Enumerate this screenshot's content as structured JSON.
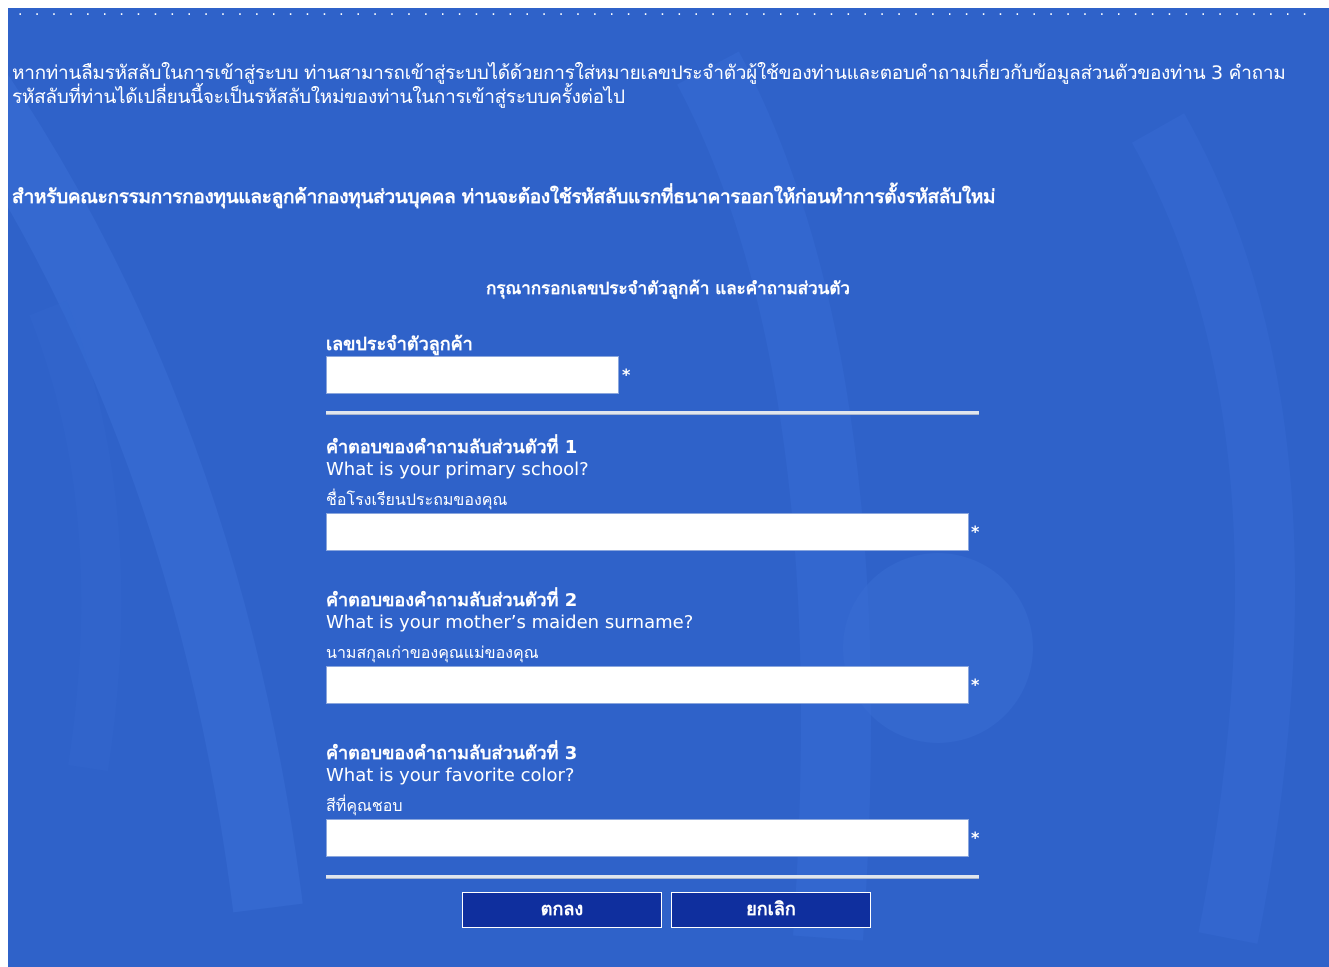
{
  "dots": "· · · · · · · · · · · · · · · · · · · · · · · · · · · · · · · · · · · · · · · · · · · · · · · · · · · · · · · · · · · · · · · · · · · · · · · · · · · · · · · · · · · · · · · · · · · · · · · · ·",
  "intro": {
    "paragraph1": "หากท่านลืมรหัสลับในการเข้าสู่ระบบ ท่านสามารถเข้าสู่ระบบได้ด้วยการใส่หมายเลขประจำตัวผู้ใช้ของท่านและตอบคำถามเกี่ยวกับข้อมูลส่วนตัวของท่าน 3 คำถาม รหัสลับที่ท่านได้เปลี่ยนนี้จะเป็นรหัสลับใหม่ของท่านในการเข้าสู่ระบบครั้งต่อไป",
    "paragraph2": "สำหรับคณะกรรมการกองทุนและลูกค้ากองทุนส่วนบุคคล ท่านจะต้องใช้รหัสลับแรกที่ธนาคารออกให้ก่อนทำการตั้งรหัสลับใหม่"
  },
  "form": {
    "title": "กรุณากรอกเลขประจำตัวลูกค้า และคำถามส่วนตัว",
    "customer_id_label": "เลขประจำตัวลูกค้า",
    "customer_id_value": "",
    "required_mark": "*",
    "questions": [
      {
        "label": "คำตอบของคำถามลับส่วนตัวที่ 1",
        "question_en": "What is your primary school?",
        "question_th": "ชื่อโรงเรียนประถมของคุณ",
        "value": ""
      },
      {
        "label": "คำตอบของคำถามลับส่วนตัวที่ 2",
        "question_en": "What is your mother’s maiden surname?",
        "question_th": "นามสกุลเก่าของคุณแม่ของคุณ",
        "value": ""
      },
      {
        "label": "คำตอบของคำถามลับส่วนตัวที่ 3",
        "question_en": "What is your favorite color?",
        "question_th": "สีที่คุณชอบ",
        "value": ""
      }
    ],
    "ok_label": "ตกลง",
    "cancel_label": "ยกเลิก"
  },
  "colors": {
    "background": "#2f62c9",
    "button": "#0f2f9e",
    "text": "#ffffff"
  }
}
